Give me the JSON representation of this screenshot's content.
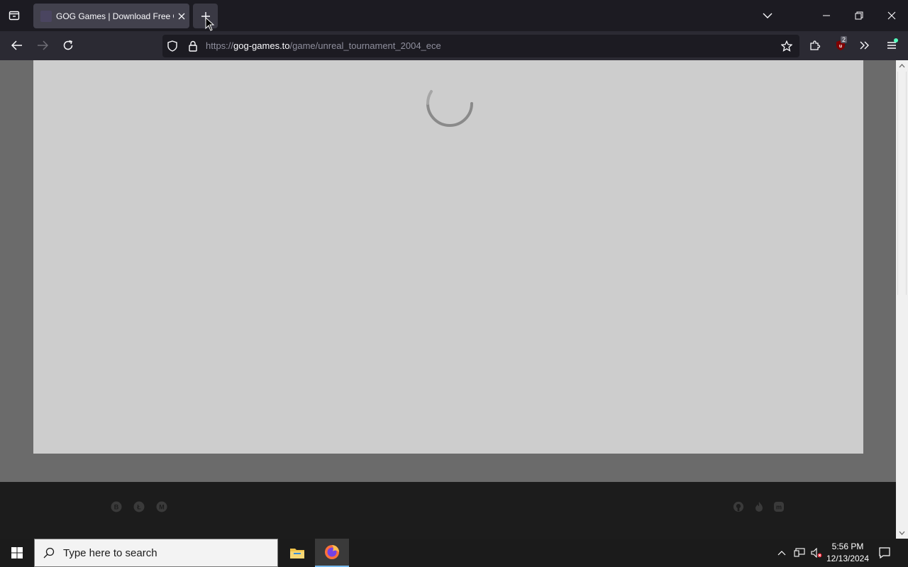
{
  "browser": {
    "tab_title": "GOG Games | Download Free GOG PC Games",
    "url_scheme": "https://",
    "url_host": "gog-games.to",
    "url_path": "/game/unreal_tournament_2004_ece",
    "extension_badge": "2"
  },
  "taskbar": {
    "search_placeholder": "Type here to search",
    "time": "5:56 PM",
    "date": "12/13/2024"
  },
  "colors": {
    "page_bg": "#6b6b6b",
    "panel_bg": "#cdcdcd",
    "footer_bg": "#1c1c1c"
  }
}
